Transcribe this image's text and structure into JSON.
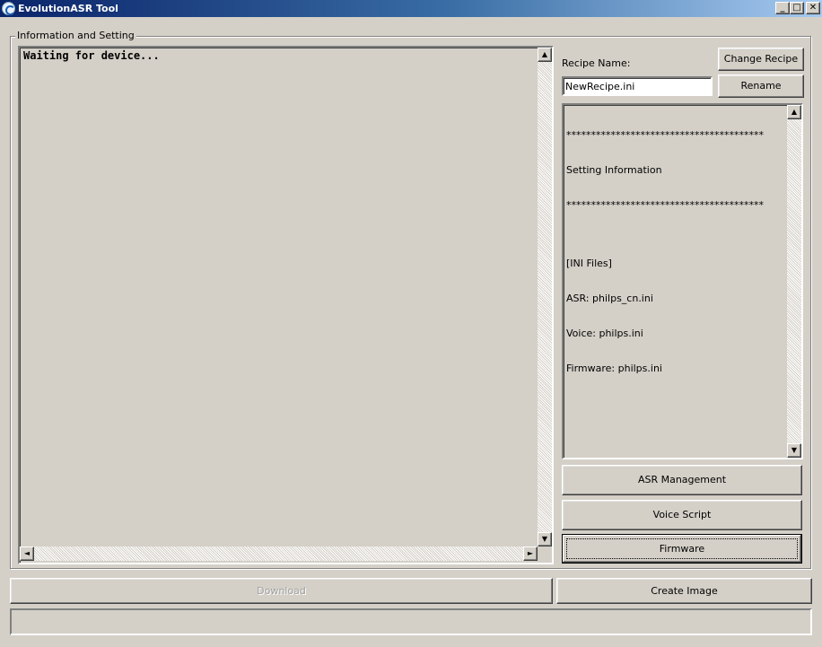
{
  "window": {
    "title": "EvolutionASR Tool",
    "controls": {
      "minimize": "_",
      "maximize": "□",
      "close": "✕"
    }
  },
  "group": {
    "label": "Information and Setting"
  },
  "log": {
    "text": "Waiting for device..."
  },
  "recipe": {
    "label": "Recipe Name:",
    "value": "NewRecipe.ini",
    "change_button": "Change Recipe",
    "rename_button": "Rename"
  },
  "info": {
    "lines": [
      "****************************************",
      "Setting Information",
      "****************************************",
      "",
      "[INI Files]",
      "ASR: philps_cn.ini",
      "Voice: philps.ini",
      "Firmware: philps.ini"
    ]
  },
  "buttons": {
    "asr_management": "ASR Management",
    "voice_script": "Voice Script",
    "firmware": "Firmware",
    "download": "Download",
    "create_image": "Create Image"
  },
  "scroll_glyphs": {
    "up": "▲",
    "down": "▼",
    "left": "◄",
    "right": "►"
  }
}
